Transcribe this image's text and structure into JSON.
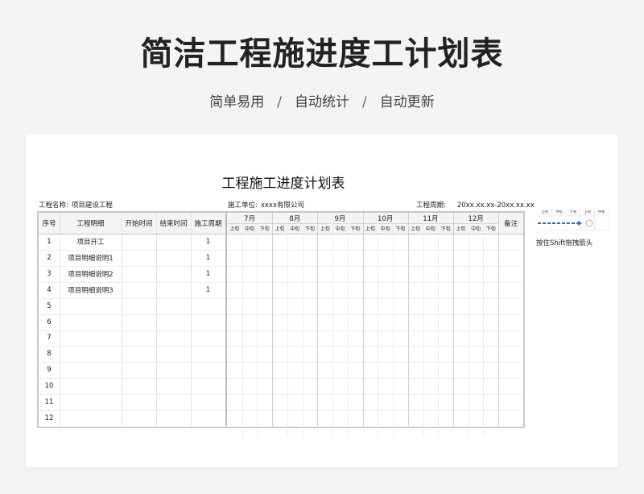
{
  "hero": {
    "title": "简洁工程施进度工计划表",
    "subtitle": [
      "简单易用",
      "自动统计",
      "自动更新"
    ],
    "separator": "/"
  },
  "sheet": {
    "title": "工程施工进度计划表",
    "project_name_label": "工程名称:",
    "project_name": "项目建设工程",
    "unit_label": "施工单位:",
    "unit": "xxxx有限公司",
    "period_label": "工程周期:",
    "period": "20xx.xx.xx-20xx.xx.xx"
  },
  "table": {
    "headers": {
      "index": "序号",
      "detail": "工程明细",
      "start": "开始时间",
      "end": "结束时间",
      "duration": "施工周期",
      "remark": "备注"
    },
    "months": [
      "7月",
      "8月",
      "9月",
      "10月",
      "11月",
      "12月"
    ],
    "periods": [
      "上旬",
      "中旬",
      "下旬"
    ],
    "rows": [
      {
        "index": "1",
        "detail": "项目开工",
        "start": "",
        "end": "",
        "duration": "1"
      },
      {
        "index": "2",
        "detail": "项目明细说明1",
        "start": "",
        "end": "",
        "duration": "1"
      },
      {
        "index": "3",
        "detail": "项目明细说明2",
        "start": "",
        "end": "",
        "duration": "1"
      },
      {
        "index": "4",
        "detail": "项目明细说明3",
        "start": "",
        "end": "",
        "duration": "1"
      },
      {
        "index": "5",
        "detail": "",
        "start": "",
        "end": "",
        "duration": ""
      },
      {
        "index": "6",
        "detail": "",
        "start": "",
        "end": "",
        "duration": ""
      },
      {
        "index": "7",
        "detail": "",
        "start": "",
        "end": "",
        "duration": ""
      },
      {
        "index": "8",
        "detail": "",
        "start": "",
        "end": "",
        "duration": ""
      },
      {
        "index": "9",
        "detail": "",
        "start": "",
        "end": "",
        "duration": ""
      },
      {
        "index": "10",
        "detail": "",
        "start": "",
        "end": "",
        "duration": ""
      },
      {
        "index": "11",
        "detail": "",
        "start": "",
        "end": "",
        "duration": ""
      },
      {
        "index": "12",
        "detail": "",
        "start": "",
        "end": "",
        "duration": ""
      }
    ]
  },
  "legend": {
    "periods": [
      "上旬",
      "中旬",
      "下旬",
      "上旬",
      "中旬"
    ],
    "hint": "按住Shift拖拽箭头",
    "arrow_color": "#2f6db5"
  }
}
